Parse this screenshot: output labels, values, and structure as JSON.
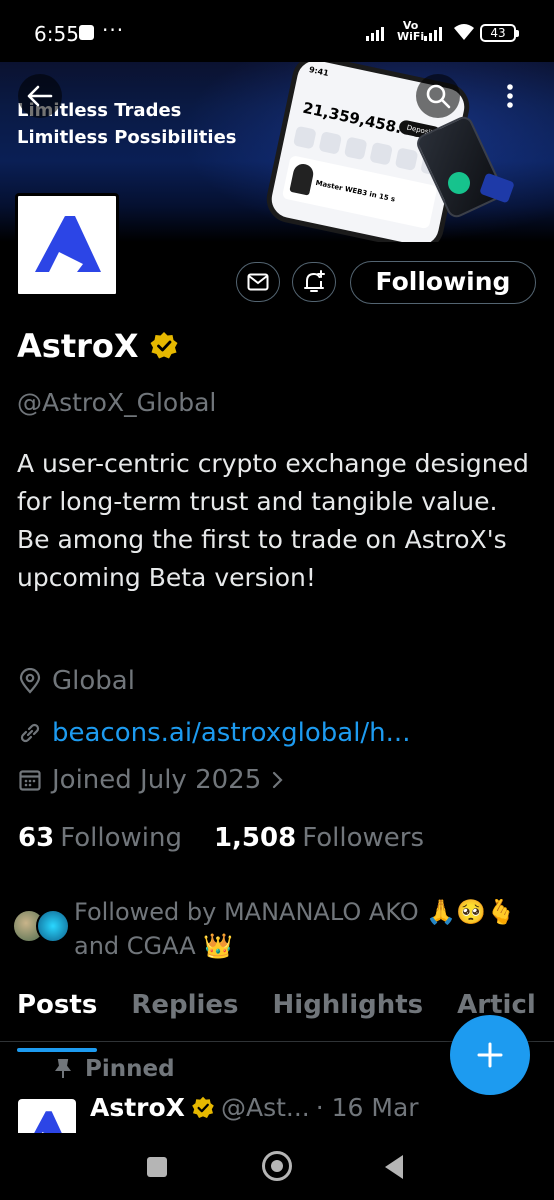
{
  "status_bar": {
    "time": "6:55",
    "more": "···",
    "network_line1": "Vo",
    "network_line2": "WiFi",
    "battery": "43"
  },
  "banner": {
    "line1": "Limitless Trades",
    "line2": "Limitless Possibilities",
    "phone_time": "9:41",
    "phone_balance": "21,359,458.00",
    "phone_deposit": "Deposit",
    "phone_card_text": "Master WEB3 in 15 s"
  },
  "profile": {
    "name": "AstroX",
    "handle": "@AstroX_Global",
    "bio": "A user-centric crypto exchange designed for long-term trust and tangible value. Be among the first to trade on AstroX's upcoming Beta version!",
    "location": "Global",
    "link": "beacons.ai/astroxglobal/h...",
    "joined": "Joined July 2025",
    "following_count": "63",
    "following_label": "Following",
    "followers_count": "1,508",
    "followers_label": "Followers",
    "followed_by": "Followed by MANANALO AKO 🙏🥺🫰 and CGAA 👑",
    "follow_button": "Following"
  },
  "tabs": [
    "Posts",
    "Replies",
    "Highlights",
    "Articl"
  ],
  "active_tab": "Posts",
  "pinned_post": {
    "pinned_label": "Pinned",
    "name": "AstroX",
    "handle": "@Ast...",
    "date": "· 16 Mar"
  },
  "colors": {
    "accent": "#1d9bf0",
    "verified": "#e6b800",
    "muted": "#71767b",
    "background": "#000000"
  }
}
